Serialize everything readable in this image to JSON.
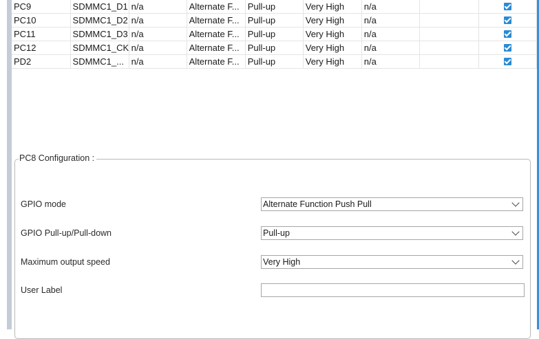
{
  "pin_table": {
    "rows": [
      {
        "pin": "PC9",
        "signal": "SDMMC1_D1",
        "output_level": "n/a",
        "mode": "Alternate F...",
        "pull": "Pull-up",
        "speed": "Very High",
        "fast_mode": "n/a",
        "user_label": "",
        "modified": true
      },
      {
        "pin": "PC10",
        "signal": "SDMMC1_D2",
        "output_level": "n/a",
        "mode": "Alternate F...",
        "pull": "Pull-up",
        "speed": "Very High",
        "fast_mode": "n/a",
        "user_label": "",
        "modified": true
      },
      {
        "pin": "PC11",
        "signal": "SDMMC1_D3",
        "output_level": "n/a",
        "mode": "Alternate F...",
        "pull": "Pull-up",
        "speed": "Very High",
        "fast_mode": "n/a",
        "user_label": "",
        "modified": true
      },
      {
        "pin": "PC12",
        "signal": "SDMMC1_CK",
        "output_level": "n/a",
        "mode": "Alternate F...",
        "pull": "Pull-up",
        "speed": "Very High",
        "fast_mode": "n/a",
        "user_label": "",
        "modified": true
      },
      {
        "pin": "PD2",
        "signal": "SDMMC1_...",
        "output_level": "n/a",
        "mode": "Alternate F...",
        "pull": "Pull-up",
        "speed": "Very High",
        "fast_mode": "n/a",
        "user_label": "",
        "modified": true
      }
    ]
  },
  "config": {
    "title": "PC8 Configuration :",
    "gpio_mode": {
      "label": "GPIO mode",
      "value": "Alternate Function Push Pull"
    },
    "pull": {
      "label": "GPIO Pull-up/Pull-down",
      "value": "Pull-up"
    },
    "speed": {
      "label": "Maximum output speed",
      "value": "Very High"
    },
    "user_label": {
      "label": "User Label",
      "value": ""
    }
  },
  "colors": {
    "accent": "#2a8ad4",
    "rail": "#c4ccd7",
    "border": "#e4e4e4"
  }
}
